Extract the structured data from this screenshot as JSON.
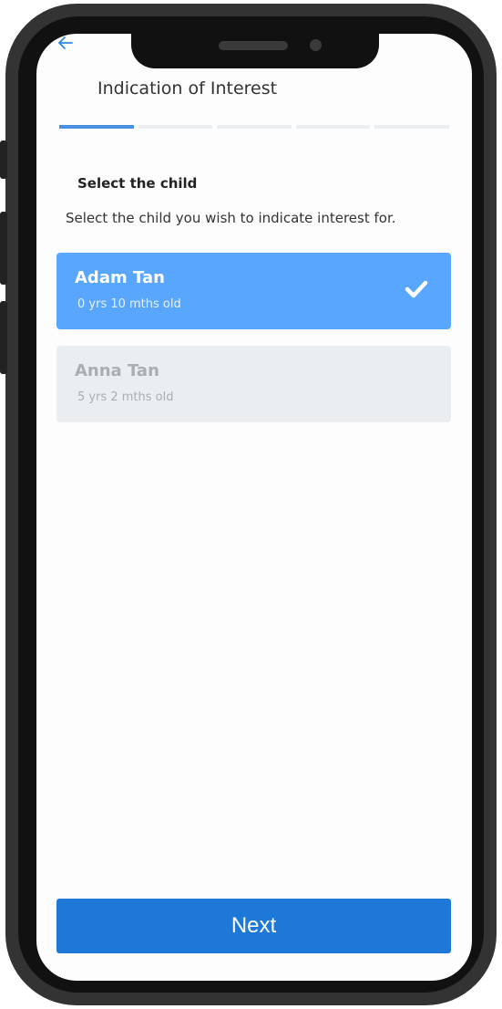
{
  "header": {
    "title": "Indication of Interest",
    "back_icon": "arrow-left-icon"
  },
  "progress": {
    "total_steps": 5,
    "current_step": 1
  },
  "section": {
    "heading": "Select the child",
    "description": "Select the child you wish to indicate interest for."
  },
  "children": [
    {
      "name": "Adam Tan",
      "age": "0 yrs 10 mths old",
      "selected": true
    },
    {
      "name": "Anna Tan",
      "age": "5 yrs 2 mths old",
      "selected": false
    }
  ],
  "footer": {
    "next_label": "Next"
  },
  "colors": {
    "accent": "#58a6fd",
    "primary_button": "#1e78d8",
    "progress_active": "#4a90e2"
  }
}
